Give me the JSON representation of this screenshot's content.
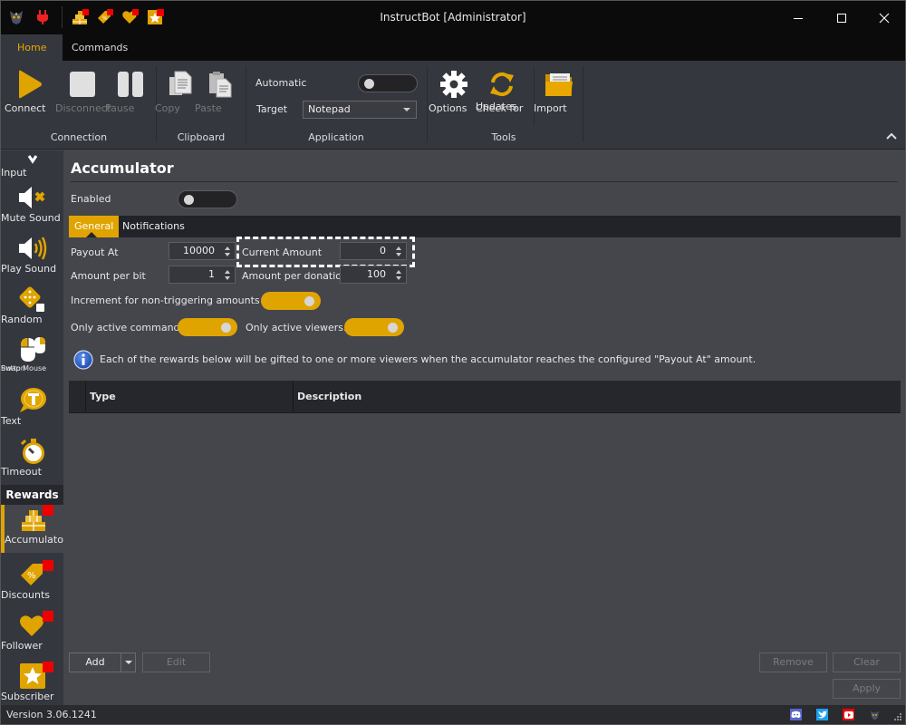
{
  "window": {
    "title": "InstructBot [Administrator]",
    "quick_access_icons": [
      "app-logo-icon",
      "plug-icon",
      "accumulator-icon",
      "discount-tag-icon",
      "follower-heart-icon",
      "subscriber-star-icon"
    ],
    "controls": [
      "minimize",
      "maximize",
      "close"
    ]
  },
  "ribbon": {
    "tabs": [
      {
        "label": "Home",
        "active": true
      },
      {
        "label": "Commands",
        "active": false
      }
    ],
    "groups": {
      "connection": {
        "label": "Connection",
        "buttons": [
          {
            "label": "Connect",
            "icon": "play-icon",
            "enabled": true
          },
          {
            "label": "Disconnect",
            "icon": "stop-icon",
            "enabled": false
          },
          {
            "label": "Pause",
            "icon": "pause-icon",
            "enabled": false
          }
        ]
      },
      "clipboard": {
        "label": "Clipboard",
        "buttons": [
          {
            "label": "Copy",
            "icon": "copy-icon",
            "enabled": false
          },
          {
            "label": "Paste",
            "icon": "paste-icon",
            "enabled": false
          }
        ]
      },
      "application": {
        "label": "Application",
        "automatic_label": "Automatic",
        "automatic_on": false,
        "target_label": "Target",
        "target_value": "Notepad"
      },
      "tools": {
        "label": "Tools",
        "buttons": [
          {
            "label": "Options",
            "icon": "gear-icon"
          },
          {
            "label": "Check for\nUpdates",
            "line1": "Check for",
            "line2": "Updates",
            "icon": "refresh-icon"
          }
        ]
      },
      "import": {
        "buttons": [
          {
            "label": "Import",
            "icon": "folder-icon"
          }
        ]
      }
    }
  },
  "sidebar": {
    "items": [
      {
        "label": "Input",
        "icon": "input-icon"
      },
      {
        "label": "Mute Sound",
        "icon": "mute-sound-icon"
      },
      {
        "label": "Play Sound",
        "icon": "play-sound-icon"
      },
      {
        "label": "Random",
        "icon": "dice-icon"
      },
      {
        "label": "Swap Mouse Button",
        "line1": "Swap Mouse",
        "line2": "Button",
        "icon": "mouse-icon"
      },
      {
        "label": "Text",
        "icon": "text-bubble-icon"
      },
      {
        "label": "Timeout",
        "icon": "stopwatch-icon"
      }
    ],
    "section": "Rewards",
    "reward_items": [
      {
        "label": "Accumulator",
        "icon": "accumulator-icon",
        "active": true
      },
      {
        "label": "Discounts",
        "icon": "discount-tag-icon",
        "active": false
      },
      {
        "label": "Follower",
        "icon": "follower-heart-icon",
        "active": false
      },
      {
        "label": "Subscriber",
        "icon": "subscriber-star-icon",
        "active": false
      }
    ]
  },
  "main": {
    "title": "Accumulator",
    "enabled_label": "Enabled",
    "enabled_on": false,
    "tabs": [
      {
        "label": "General",
        "active": true
      },
      {
        "label": "Notifications",
        "active": false
      }
    ],
    "fields": {
      "payout_at": {
        "label": "Payout At",
        "value": "10000"
      },
      "current_amount": {
        "label": "Current Amount",
        "value": "0"
      },
      "amount_per_bit": {
        "label": "Amount per bit",
        "value": "1"
      },
      "amount_per_donation": {
        "label": "Amount per donation",
        "value": "100"
      }
    },
    "toggles": {
      "increment_non_triggering": {
        "label": "Increment for non-triggering amounts only",
        "on": true
      },
      "only_active_commands": {
        "label": "Only active commands.",
        "on": true
      },
      "only_active_viewers": {
        "label": "Only active viewers.",
        "on": true
      }
    },
    "info_text": "Each of the rewards below will be gifted to one or more viewers when the accumulator reaches the configured \"Payout At\" amount.",
    "grid": {
      "columns": [
        "Type",
        "Description"
      ],
      "rows": []
    },
    "buttons": {
      "add": "Add",
      "edit": "Edit",
      "remove": "Remove",
      "clear": "Clear",
      "apply": "Apply"
    }
  },
  "statusbar": {
    "version": "Version 3.06.1241",
    "social_icons": [
      "discord-icon",
      "twitter-icon",
      "youtube-icon",
      "app-logo-icon"
    ]
  },
  "colors": {
    "accent": "#e0a400",
    "titlebar": "#0b0b0b",
    "ribbon": "#35373f",
    "panel": "#45464c",
    "badge": "#ee0000"
  }
}
